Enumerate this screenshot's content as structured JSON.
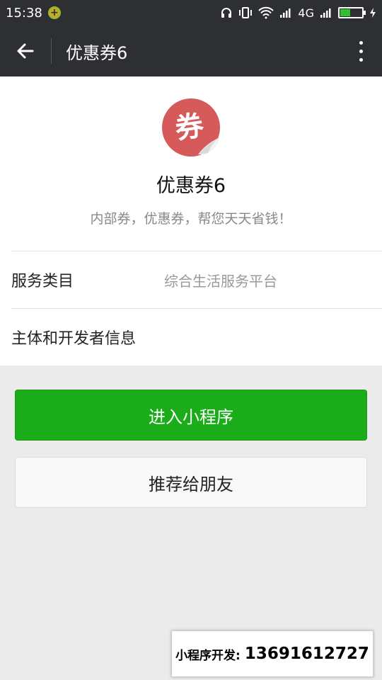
{
  "status_bar": {
    "time": "15:38",
    "network": "4G",
    "battery_level": 0.45
  },
  "nav": {
    "title": "优惠券6",
    "back_icon": "back-arrow-icon",
    "more_icon": "more-vertical-icon"
  },
  "profile": {
    "logo_char": "券",
    "logo_color": "#d65a5a",
    "name": "优惠券6",
    "description": "内部券，优惠券，帮您天天省钱！"
  },
  "info": {
    "category_label": "服务类目",
    "category_value": "综合生活服务平台",
    "developer_label": "主体和开发者信息"
  },
  "actions": {
    "enter_label": "进入小程序",
    "share_label": "推荐给朋友",
    "enter_color": "#1aad19"
  },
  "ad": {
    "label": "小程序开发:",
    "phone": "13691612727"
  }
}
